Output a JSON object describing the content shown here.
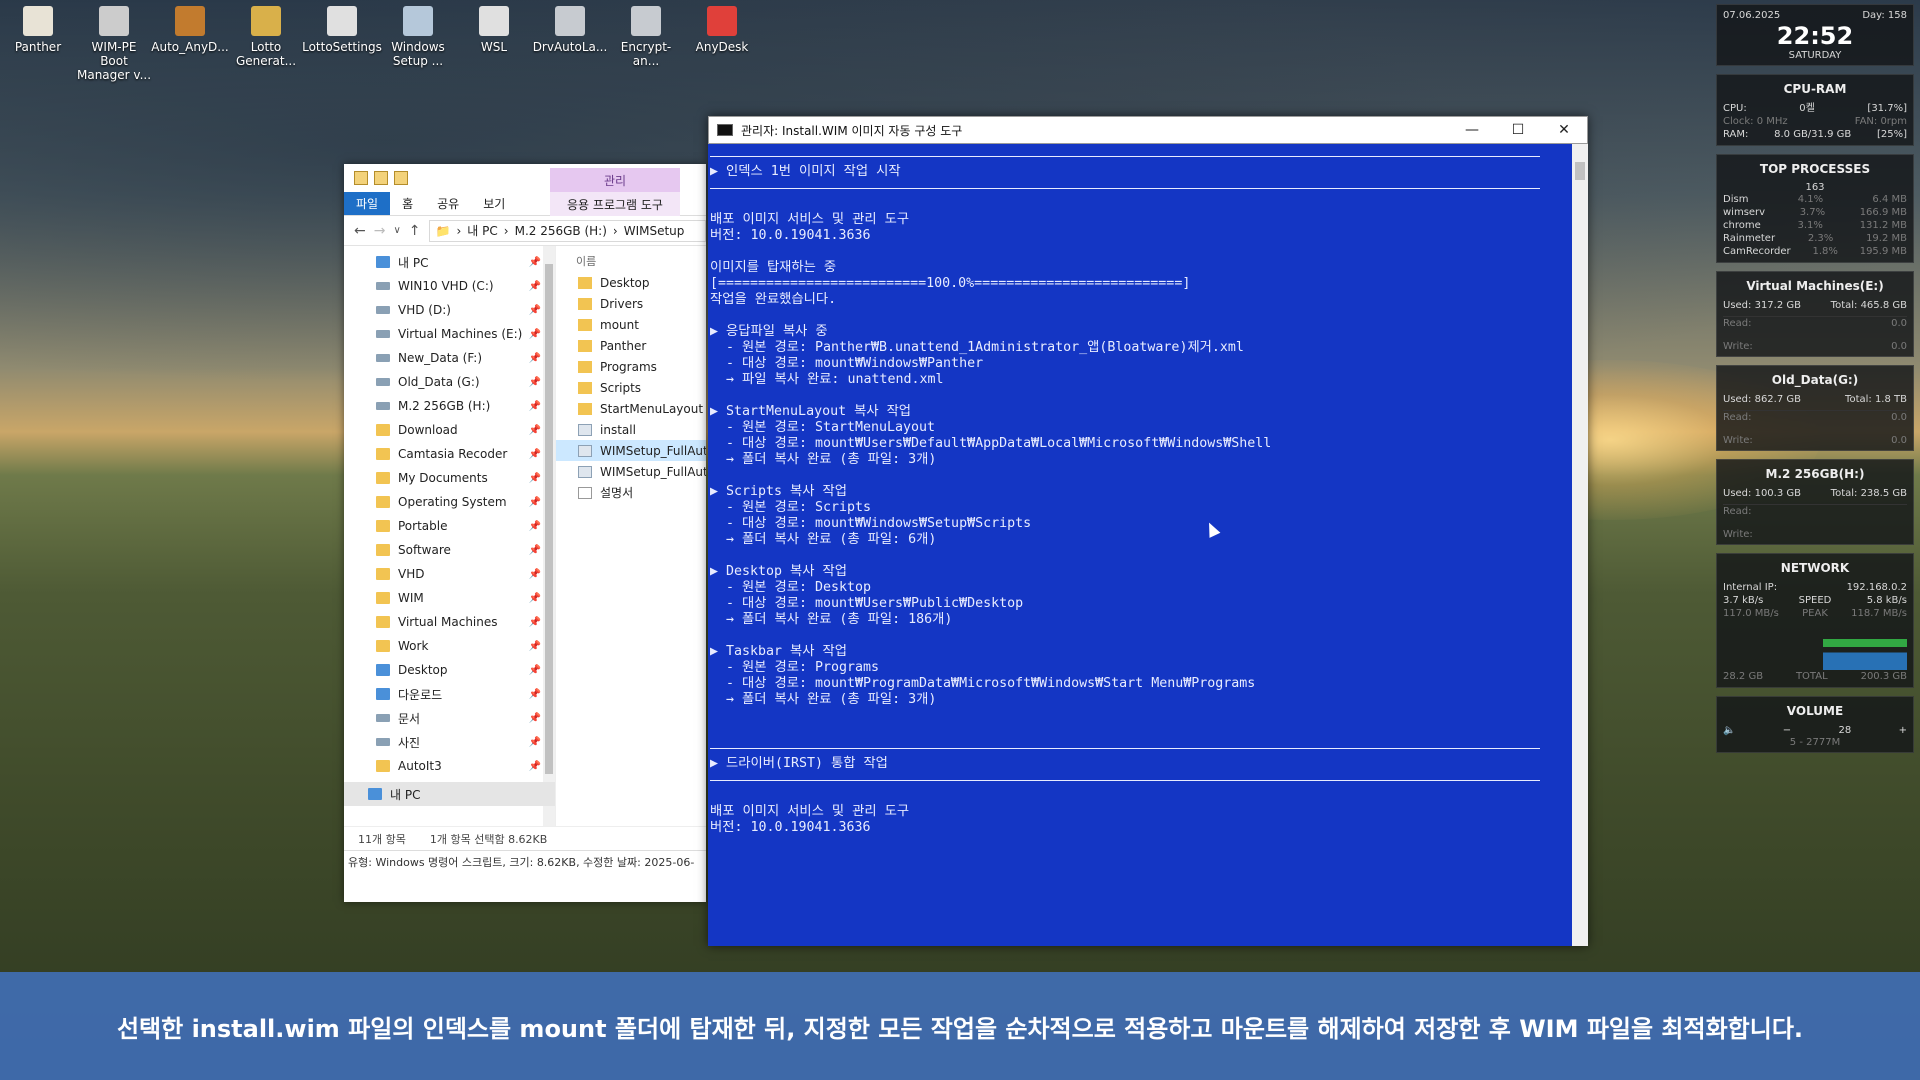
{
  "desktop": {
    "icons": [
      {
        "label": "Panther",
        "color": "#e8e3d6"
      },
      {
        "label": "WIM-PE Boot Manager v...",
        "color": "#cccccc"
      },
      {
        "label": "Auto_AnyD...",
        "color": "#c27b2e"
      },
      {
        "label": "Lotto Generat...",
        "color": "#d9b04a"
      },
      {
        "label": "LottoSettings",
        "color": "#e0e0e0"
      },
      {
        "label": "Windows Setup ...",
        "color": "#b5c8da"
      },
      {
        "label": "WSL",
        "color": "#e0e0e0"
      },
      {
        "label": "DrvAutoLa...",
        "color": "#c7cbd0"
      },
      {
        "label": "Encrypt-an...",
        "color": "#c7cbd0"
      },
      {
        "label": "AnyDesk",
        "color": "#e0403a"
      }
    ]
  },
  "explorer": {
    "manage_tab": "관리",
    "ribbon_tabs": [
      "파일",
      "홈",
      "공유",
      "보기"
    ],
    "app_tools": "응용 프로그램 도구",
    "breadcrumb": [
      "내 PC",
      "M.2 256GB (H:)",
      "WIMSetup"
    ],
    "nav_items": [
      {
        "label": "내 PC",
        "type": "pc"
      },
      {
        "label": "WIN10 VHD (C:)",
        "type": "drive"
      },
      {
        "label": "VHD (D:)",
        "type": "drive"
      },
      {
        "label": "Virtual Machines (E:)",
        "type": "drive"
      },
      {
        "label": "New_Data (F:)",
        "type": "drive"
      },
      {
        "label": "Old_Data (G:)",
        "type": "drive"
      },
      {
        "label": "M.2 256GB (H:)",
        "type": "drive"
      },
      {
        "label": "Download",
        "type": "folder"
      },
      {
        "label": "Camtasia Recoder",
        "type": "folder"
      },
      {
        "label": "My Documents",
        "type": "folder"
      },
      {
        "label": "Operating System",
        "type": "folder"
      },
      {
        "label": "Portable",
        "type": "folder"
      },
      {
        "label": "Software",
        "type": "folder"
      },
      {
        "label": "VHD",
        "type": "folder"
      },
      {
        "label": "WIM",
        "type": "folder"
      },
      {
        "label": "Virtual Machines",
        "type": "folder"
      },
      {
        "label": "Work",
        "type": "folder"
      },
      {
        "label": "Desktop",
        "type": "pc"
      },
      {
        "label": "다운로드",
        "type": "pc"
      },
      {
        "label": "문서",
        "type": "drive"
      },
      {
        "label": "사진",
        "type": "drive"
      },
      {
        "label": "AutoIt3",
        "type": "folder"
      }
    ],
    "nav_selected": "내 PC",
    "column_name": "이름",
    "files": [
      {
        "label": "Desktop",
        "type": "folder"
      },
      {
        "label": "Drivers",
        "type": "folder"
      },
      {
        "label": "mount",
        "type": "folder"
      },
      {
        "label": "Panther",
        "type": "folder"
      },
      {
        "label": "Programs",
        "type": "folder"
      },
      {
        "label": "Scripts",
        "type": "folder"
      },
      {
        "label": "StartMenuLayout",
        "type": "folder"
      },
      {
        "label": "install",
        "type": "wim"
      },
      {
        "label": "WIMSetup_FullAut",
        "type": "wim",
        "selected": true
      },
      {
        "label": "WIMSetup_FullAut",
        "type": "wim"
      },
      {
        "label": "설명서",
        "type": "doc"
      }
    ],
    "status_count": "11개 항목",
    "status_selected": "1개 항목 선택함 8.62KB",
    "detail_line": "유형: Windows 명령어 스크립트, 크기: 8.62KB, 수정한 날짜: 2025-06-"
  },
  "console": {
    "title": "관리자:  Install.WIM 이미지 자동 구성 도구",
    "lines": [
      {
        "t": "rule"
      },
      {
        "t": "text",
        "v": "▶ 인덱스 1번 이미지 작업 시작"
      },
      {
        "t": "rule"
      },
      {
        "t": "gap"
      },
      {
        "t": "text",
        "v": "배포 이미지 서비스 및 관리 도구"
      },
      {
        "t": "text",
        "v": "버전: 10.0.19041.3636"
      },
      {
        "t": "gap"
      },
      {
        "t": "text",
        "v": "이미지를 탑재하는 중"
      },
      {
        "t": "text",
        "v": "[==========================100.0%==========================]"
      },
      {
        "t": "text",
        "v": "작업을 완료했습니다."
      },
      {
        "t": "gap"
      },
      {
        "t": "text",
        "v": "▶ 응답파일 복사 중"
      },
      {
        "t": "text",
        "v": "  - 원본 경로: Panther₩B.unattend_1Administrator_앱(Bloatware)제거.xml"
      },
      {
        "t": "text",
        "v": "  - 대상 경로: mount₩Windows₩Panther"
      },
      {
        "t": "text",
        "v": "  → 파일 복사 완료: unattend.xml"
      },
      {
        "t": "gap"
      },
      {
        "t": "text",
        "v": "▶ StartMenuLayout 복사 작업"
      },
      {
        "t": "text",
        "v": "  - 원본 경로: StartMenuLayout"
      },
      {
        "t": "text",
        "v": "  - 대상 경로: mount₩Users₩Default₩AppData₩Local₩Microsoft₩Windows₩Shell"
      },
      {
        "t": "text",
        "v": "  → 폴더 복사 완료 (총 파일: 3개)"
      },
      {
        "t": "gap"
      },
      {
        "t": "text",
        "v": "▶ Scripts 복사 작업"
      },
      {
        "t": "text",
        "v": "  - 원본 경로: Scripts"
      },
      {
        "t": "text",
        "v": "  - 대상 경로: mount₩Windows₩Setup₩Scripts"
      },
      {
        "t": "text",
        "v": "  → 폴더 복사 완료 (총 파일: 6개)"
      },
      {
        "t": "gap"
      },
      {
        "t": "text",
        "v": "▶ Desktop 복사 작업"
      },
      {
        "t": "text",
        "v": "  - 원본 경로: Desktop"
      },
      {
        "t": "text",
        "v": "  - 대상 경로: mount₩Users₩Public₩Desktop"
      },
      {
        "t": "text",
        "v": "  → 폴더 복사 완료 (총 파일: 186개)"
      },
      {
        "t": "gap"
      },
      {
        "t": "text",
        "v": "▶ Taskbar 복사 작업"
      },
      {
        "t": "text",
        "v": "  - 원본 경로: Programs"
      },
      {
        "t": "text",
        "v": "  - 대상 경로: mount₩ProgramData₩Microsoft₩Windows₩Start Menu₩Programs"
      },
      {
        "t": "text",
        "v": "  → 폴더 복사 완료 (총 파일: 3개)"
      },
      {
        "t": "gap"
      },
      {
        "t": "gap"
      },
      {
        "t": "rule"
      },
      {
        "t": "text",
        "v": "▶ 드라이버(IRST) 통합 작업"
      },
      {
        "t": "rule"
      },
      {
        "t": "gap"
      },
      {
        "t": "text",
        "v": "배포 이미지 서비스 및 관리 도구"
      },
      {
        "t": "text",
        "v": "버전: 10.0.19041.3636"
      }
    ]
  },
  "widgets": {
    "clock": {
      "date": "07.06.2025",
      "day": "Day: 158",
      "time": "22:52",
      "weekday": "SATURDAY"
    },
    "cpu_ram": {
      "title": "CPU-RAM",
      "cpu_label": "CPU:",
      "cpu_value": "0켈",
      "cpu_pct": "[31.7%]",
      "clock": "Clock: 0 MHz",
      "fan": "FAN: 0rpm",
      "ram_label": "RAM:",
      "ram_value": "8.0 GB/31.9 GB",
      "ram_pct": "[25%]"
    },
    "top": {
      "title": "TOP PROCESSES",
      "count": "163",
      "procs": [
        {
          "name": "Dism",
          "cpu": "4.1%",
          "mem": "6.4 MB"
        },
        {
          "name": "wimserv",
          "cpu": "3.7%",
          "mem": "166.9 MB"
        },
        {
          "name": "chrome",
          "cpu": "3.1%",
          "mem": "131.2 MB"
        },
        {
          "name": "Rainmeter",
          "cpu": "2.3%",
          "mem": "19.2 MB"
        },
        {
          "name": "CamRecorder",
          "cpu": "1.8%",
          "mem": "195.9 MB"
        }
      ]
    },
    "disks": [
      {
        "title": "Virtual Machines(E:)",
        "used": "Used: 317.2 GB",
        "total": "Total: 465.8 GB",
        "read": "Read:",
        "write": "Write:",
        "rv": "0.0",
        "wv": "0.0"
      },
      {
        "title": "Old_Data(G:)",
        "used": "Used: 862.7 GB",
        "total": "Total: 1.8 TB",
        "read": "Read:",
        "write": "Write:",
        "rv": "0.0",
        "wv": "0.0"
      },
      {
        "title": "M.2 256GB(H:)",
        "used": "Used: 100.3 GB",
        "total": "Total: 238.5 GB",
        "read": "Read:",
        "write": "Write:",
        "rv": "",
        "wv": ""
      }
    ],
    "network": {
      "title": "NETWORK",
      "ip_label": "Internal IP:",
      "ip": "192.168.0.2",
      "up": "3.7 kB/s",
      "speed_label": "SPEED",
      "speed": "5.8 kB/s",
      "down": "117.0 MB/s",
      "peak_label": "PEAK",
      "peak": "118.7 MB/s",
      "total_left": "28.2 GB",
      "total_label": "TOTAL",
      "total_right": "200.3 GB"
    },
    "volume": {
      "title": "VOLUME",
      "value": "28",
      "device": "5 - 2777M"
    }
  },
  "caption": "선택한 install.wim 파일의 인덱스를 mount 폴더에 탑재한 뒤, 지정한 모든 작업을 순차적으로 적용하고 마운트를 해제하여 저장한 후 WIM 파일을 최적화합니다."
}
